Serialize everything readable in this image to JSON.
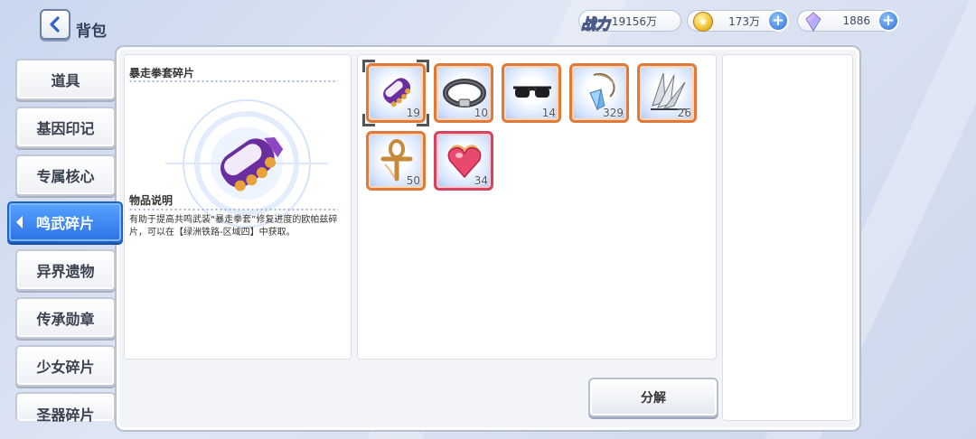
{
  "header": {
    "title": "背包",
    "power_label": "战力",
    "power_value": "19156万",
    "gold_value": "173万",
    "gem_value": "1886"
  },
  "detail": {
    "item_name": "暴走拳套碎片",
    "desc_title": "物品说明",
    "desc_text": "有助于提高共鸣武装“暴走拳套”修复进度的欧帕兹碎片，可以在【绿洲铁路-区域四】中获取。"
  },
  "inventory": {
    "items": [
      {
        "name": "glove-fragment",
        "count": "19",
        "selected": true
      },
      {
        "name": "collar-fragment",
        "count": "10"
      },
      {
        "name": "sunglasses-fragment",
        "count": "14"
      },
      {
        "name": "pendant-fragment",
        "count": "329"
      },
      {
        "name": "feather-blades-fragment",
        "count": "26"
      },
      {
        "name": "ankh-fragment",
        "count": "50"
      },
      {
        "name": "heart-fragment",
        "count": "34"
      }
    ]
  },
  "actions": {
    "decompose_label": "分解"
  },
  "tabs": [
    {
      "label": "道具"
    },
    {
      "label": "基因印记"
    },
    {
      "label": "专属核心"
    },
    {
      "label": "鸣武碎片",
      "active": true
    },
    {
      "label": "异界遗物"
    },
    {
      "label": "传承勋章"
    },
    {
      "label": "少女碎片"
    },
    {
      "label": "圣器碎片"
    }
  ],
  "colors": {
    "accent_blue": "#2c74e6",
    "rarity_orange": "#e07a3c",
    "rarity_pink": "#d3445e"
  }
}
